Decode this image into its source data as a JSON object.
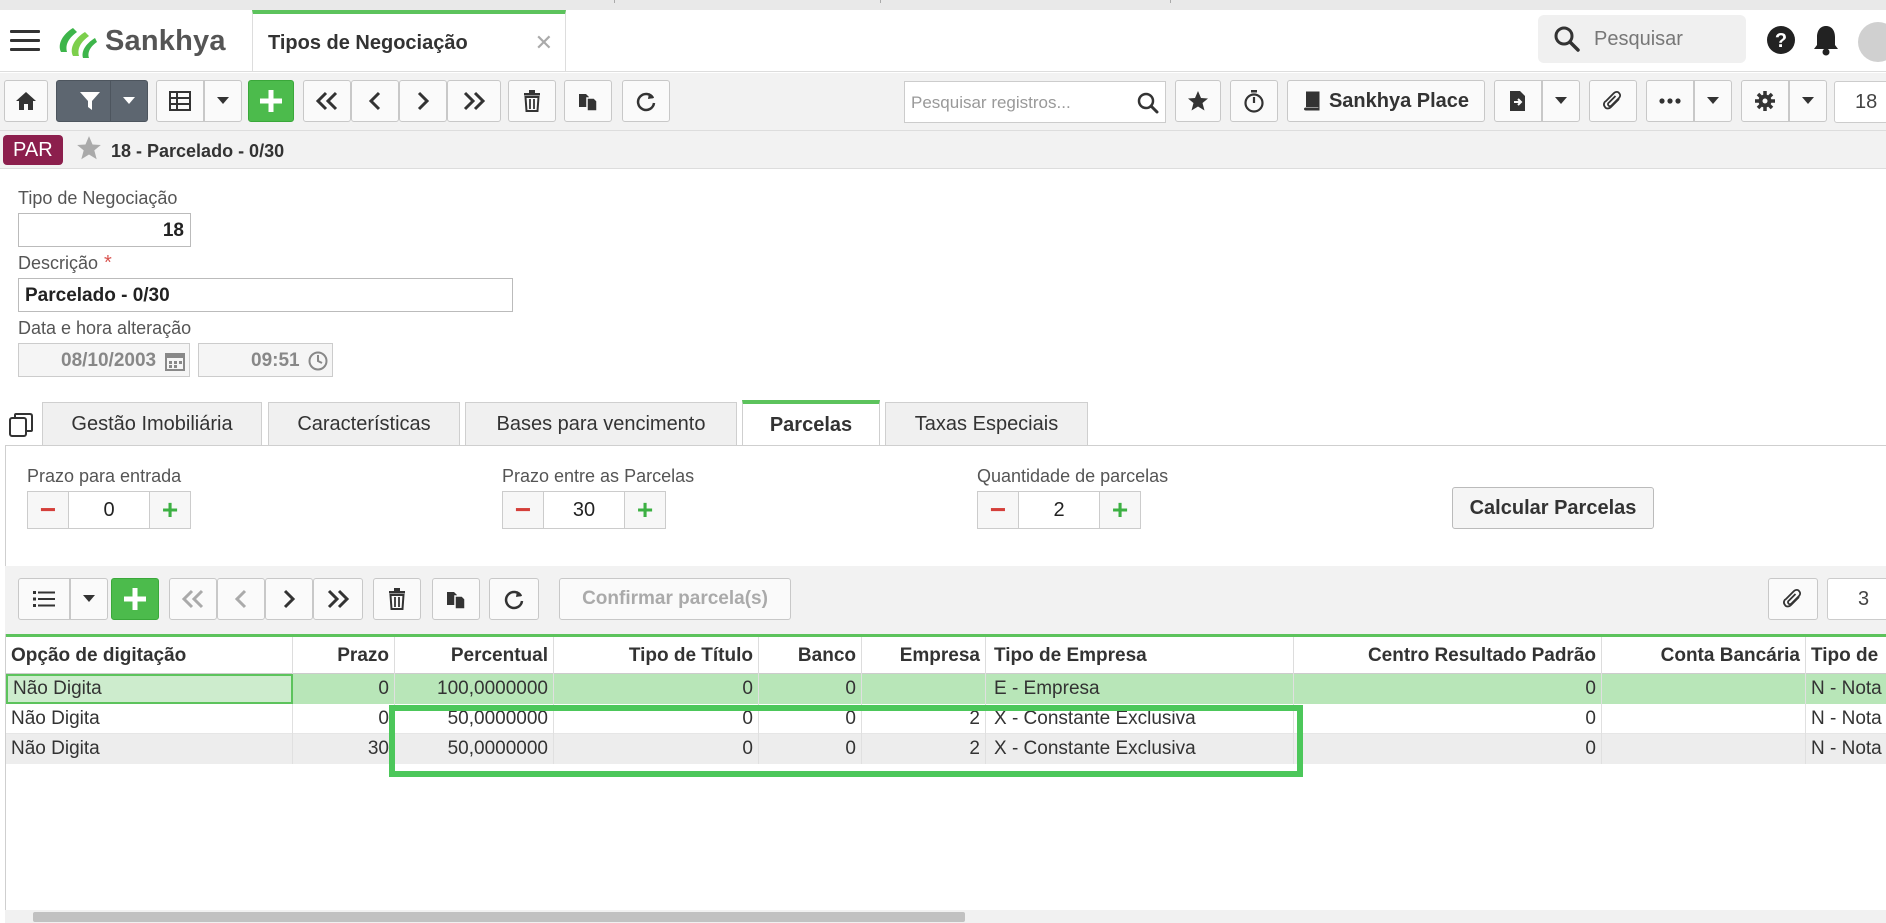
{
  "header": {
    "logo_text": "Sankhya",
    "page_tab_title": "Tipos de Negociação",
    "search_placeholder": "Pesquisar"
  },
  "toolbar": {
    "record_search_placeholder": "Pesquisar registros...",
    "sankhya_place_label": "Sankhya Place",
    "record_count": "18"
  },
  "record_bar": {
    "badge": "PAR",
    "title": "18 - Parcelado - 0/30"
  },
  "form": {
    "tipo_label": "Tipo de Negociação",
    "tipo_value": "18",
    "descricao_label": "Descrição",
    "required_mark": "*",
    "descricao_value": "Parcelado - 0/30",
    "data_label": "Data e hora alteração",
    "data_value": "08/10/2003",
    "hora_value": "09:51"
  },
  "tabs": [
    "Gestão Imobiliária",
    "Características",
    "Bases para vencimento",
    "Parcelas",
    "Taxas Especiais"
  ],
  "parcelas": {
    "prazo_entrada_label": "Prazo para entrada",
    "prazo_entrada_value": "0",
    "prazo_entre_label": "Prazo entre as Parcelas",
    "prazo_entre_value": "30",
    "quantidade_label": "Quantidade de parcelas",
    "quantidade_value": "2",
    "calcular_label": "Calcular Parcelas"
  },
  "grid_toolbar": {
    "confirm_label": "Confirmar parcela(s)",
    "page_value": "3"
  },
  "grid": {
    "columns": [
      "Opção de digitação",
      "Prazo",
      "Percentual",
      "Tipo de Título",
      "Banco",
      "Empresa",
      "Tipo de Empresa",
      "Centro Resultado Padrão",
      "Conta Bancária",
      "Tipo de"
    ],
    "rows": [
      [
        "Não Digita",
        "0",
        "100,0000000",
        "0",
        "0",
        "",
        "E - Empresa",
        "0",
        "",
        "N - Nota"
      ],
      [
        "Não Digita",
        "0",
        "50,0000000",
        "0",
        "0",
        "2",
        "X - Constante Exclusiva",
        "0",
        "",
        "N - Nota"
      ],
      [
        "Não Digita",
        "30",
        "50,0000000",
        "0",
        "0",
        "2",
        "X - Constante Exclusiva",
        "0",
        "",
        "N - Nota"
      ]
    ]
  },
  "colors": {
    "accent_green": "#5cc35c",
    "badge_bg": "#8c1f4d",
    "highlight_box": "#4cc75a",
    "selected_row": "#b8e6b8"
  },
  "icons": [
    "menu-icon",
    "sankhya-logo-icon",
    "close-icon",
    "search-icon",
    "help-icon",
    "bell-icon",
    "home-icon",
    "filter-icon",
    "grid-icon",
    "add-icon",
    "first-icon",
    "prev-icon",
    "next-icon",
    "last-icon",
    "trash-icon",
    "copy-icon",
    "refresh-icon",
    "star-icon",
    "timer-icon",
    "book-icon",
    "export-icon",
    "attach-icon",
    "more-icon",
    "gear-icon",
    "calendar-icon",
    "clock-icon",
    "list-icon"
  ]
}
